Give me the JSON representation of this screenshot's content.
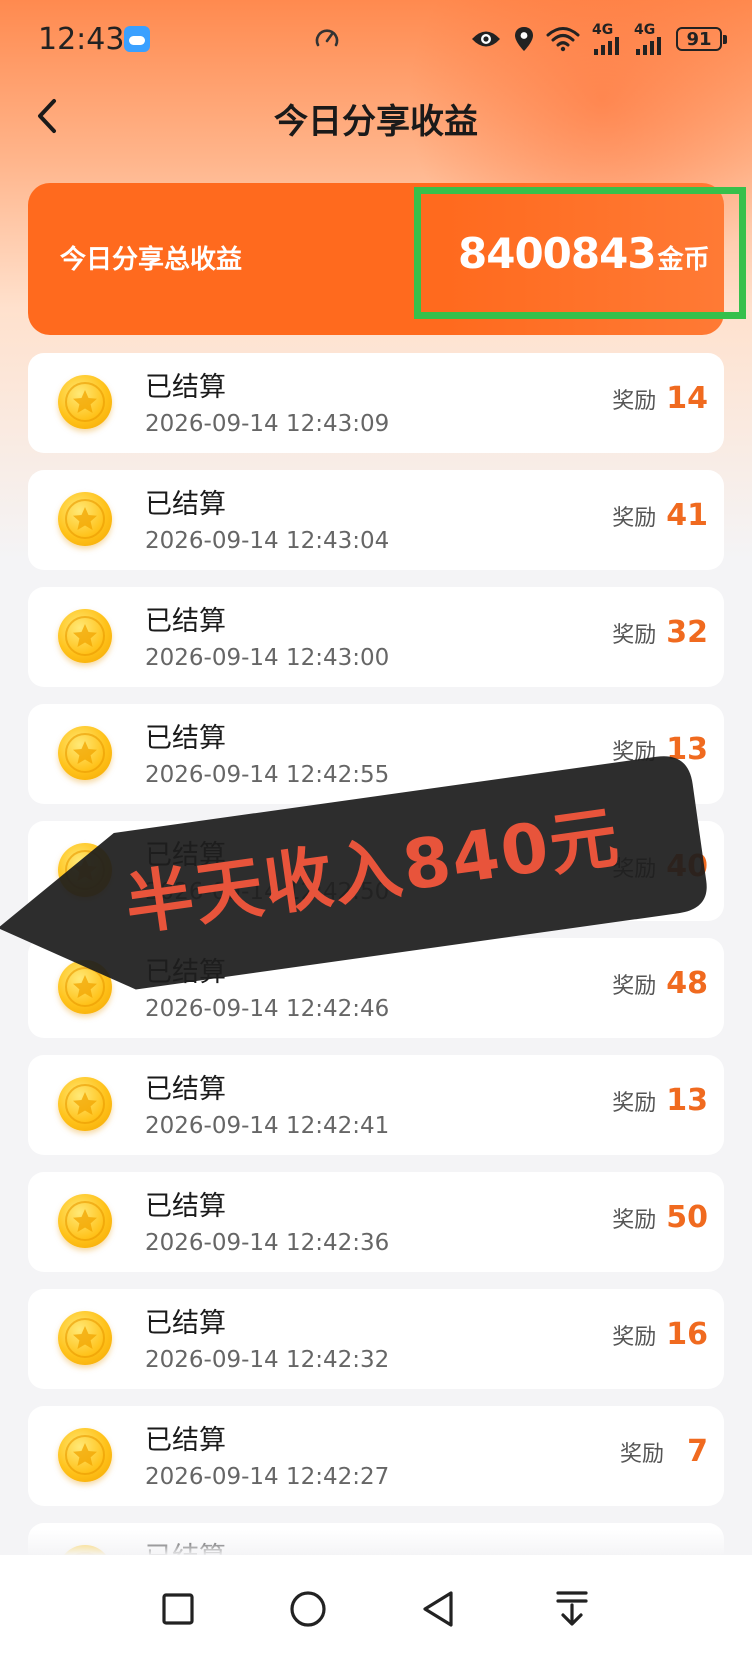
{
  "status_bar": {
    "time": "12:43",
    "network_1": "4G",
    "network_2": "4G",
    "battery": "91",
    "icons": [
      "weather-icon",
      "speed-icon",
      "eye-icon",
      "location-icon",
      "wifi-icon",
      "signal-icon",
      "signal-icon",
      "battery-icon"
    ]
  },
  "header": {
    "title": "今日分享收益",
    "back_icon": "chevron-left-icon"
  },
  "summary": {
    "label": "今日分享总收益",
    "amount": "8400843",
    "unit": "金币",
    "highlight_color": "#36c04b"
  },
  "records": [
    {
      "status": "已结算",
      "time": "2026-09-14 12:43:09",
      "reward_label": "奖励",
      "reward": "14"
    },
    {
      "status": "已结算",
      "time": "2026-09-14 12:43:04",
      "reward_label": "奖励",
      "reward": "41"
    },
    {
      "status": "已结算",
      "time": "2026-09-14 12:43:00",
      "reward_label": "奖励",
      "reward": "32"
    },
    {
      "status": "已结算",
      "time": "2026-09-14 12:42:55",
      "reward_label": "奖励",
      "reward": "13"
    },
    {
      "status": "已结算",
      "time": "2026-09-14 12:42:50",
      "reward_label": "奖励",
      "reward": "40"
    },
    {
      "status": "已结算",
      "time": "2026-09-14 12:42:46",
      "reward_label": "奖励",
      "reward": "48"
    },
    {
      "status": "已结算",
      "time": "2026-09-14 12:42:41",
      "reward_label": "奖励",
      "reward": "13"
    },
    {
      "status": "已结算",
      "time": "2026-09-14 12:42:36",
      "reward_label": "奖励",
      "reward": "50"
    },
    {
      "status": "已结算",
      "time": "2026-09-14 12:42:32",
      "reward_label": "奖励",
      "reward": "16"
    },
    {
      "status": "已结算",
      "time": "2026-09-14 12:42:27",
      "reward_label": "奖励",
      "reward": "7"
    },
    {
      "status": "已结算",
      "time": "",
      "reward_label": "",
      "reward": ""
    }
  ],
  "overlay": {
    "text": "半天收入840元"
  },
  "nav_bar": {
    "icons": [
      "recent-apps-icon",
      "home-icon",
      "back-triangle-icon",
      "notification-pull-icon"
    ]
  },
  "colors": {
    "accent": "#f06a1f",
    "banner": "#ff6a1e",
    "sticker_text": "#e8543b"
  }
}
